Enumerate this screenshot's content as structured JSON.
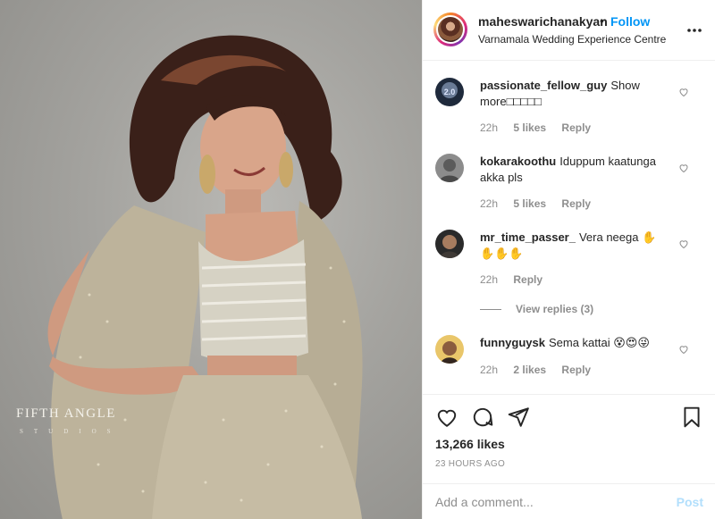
{
  "post": {
    "username": "maheswarichanakyan",
    "separator": "•",
    "follow_label": "Follow",
    "location": "Varnamala Wedding Experience Centre",
    "watermark_line1": "FIFTH ANGLE",
    "watermark_line2": "STUDIOS",
    "likes": "13,266 likes",
    "time_ago": "23 HOURS AGO"
  },
  "comments": [
    {
      "username": "passionate_fellow_guy",
      "text": "Show more□□□□□",
      "time": "22h",
      "likes": "5 likes",
      "reply": "Reply"
    },
    {
      "username": "kokarakoothu",
      "text": "Iduppum kaatunga akka pls",
      "time": "22h",
      "likes": "5 likes",
      "reply": "Reply"
    },
    {
      "username": "mr_time_passer_",
      "text": "Vera neega ✋ ✋✋✋",
      "time": "22h",
      "likes": "",
      "reply": "Reply",
      "view_replies": "View replies (3)"
    },
    {
      "username": "funnyguysk",
      "text": "Sema kattai 😵😍😜",
      "time": "22h",
      "likes": "2 likes",
      "reply": "Reply"
    }
  ],
  "add_comment": {
    "placeholder": "Add a comment...",
    "post_label": "Post"
  },
  "icons": {
    "more": "more-options-icon",
    "like": "heart-icon",
    "comment": "comment-icon",
    "share": "share-icon",
    "save": "bookmark-icon"
  },
  "colors": {
    "accent": "#0095f6",
    "post_disabled": "#b2dffc",
    "muted": "#8e8e8e",
    "text": "#262626"
  }
}
